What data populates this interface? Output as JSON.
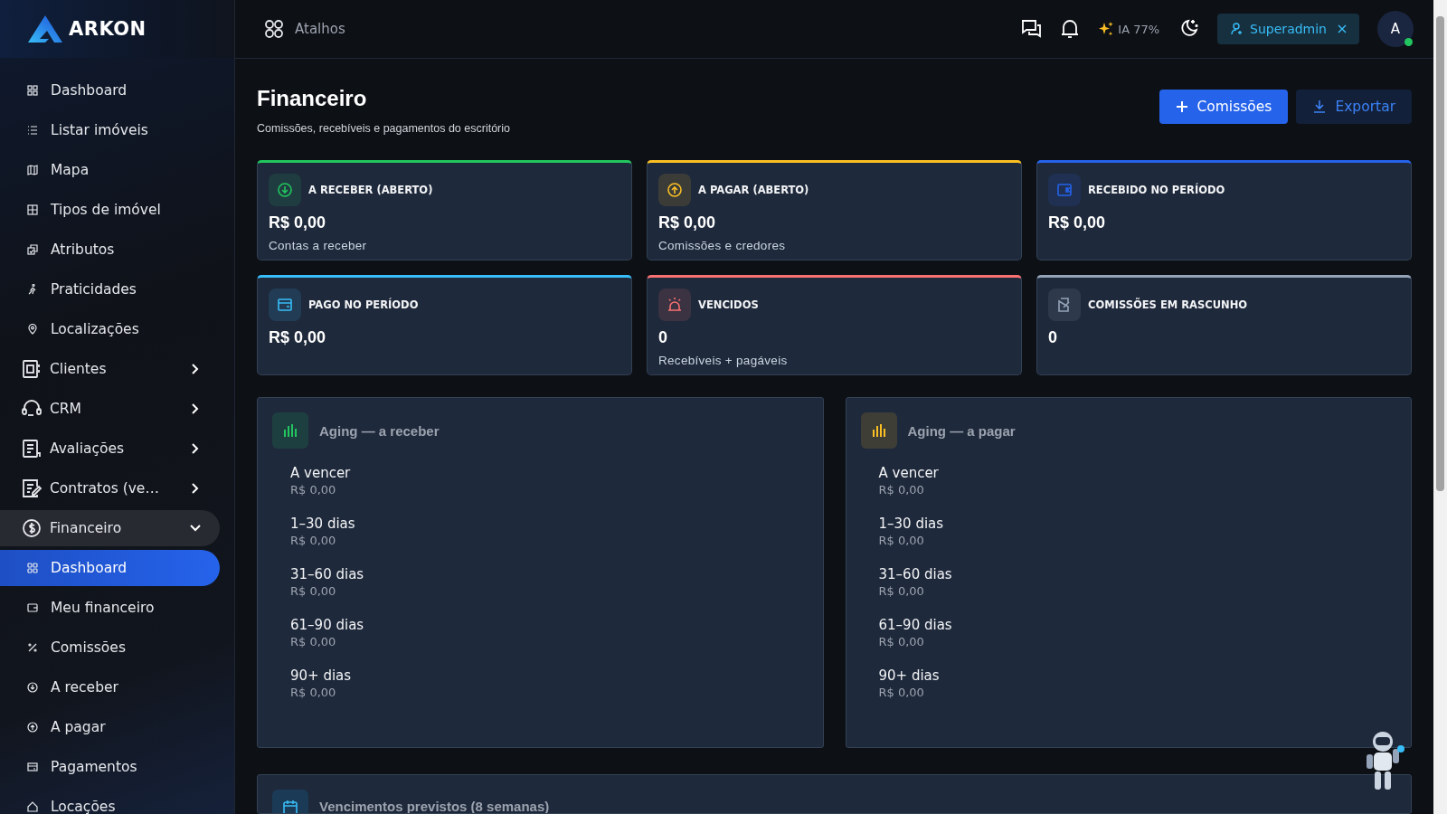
{
  "sidebar": {
    "logo": "ARKON",
    "items": [
      {
        "label": "Dashboard",
        "kind": "link",
        "selected": false
      },
      {
        "label": "Listar imóveis",
        "kind": "link",
        "selected": false
      },
      {
        "label": "Mapa",
        "kind": "link",
        "selected": false
      },
      {
        "label": "Tipos de imóvel",
        "kind": "link",
        "selected": false
      },
      {
        "label": "Atributos",
        "kind": "link",
        "selected": false
      },
      {
        "label": "Praticidades",
        "kind": "link",
        "selected": false
      },
      {
        "label": "Localizações",
        "kind": "link",
        "selected": false
      },
      {
        "label": "Clientes",
        "kind": "group",
        "expanded": false,
        "selected": false
      },
      {
        "label": "CRM",
        "kind": "group",
        "expanded": false,
        "selected": false
      },
      {
        "label": "Avaliações",
        "kind": "group",
        "expanded": false,
        "selected": false
      },
      {
        "label": "Contratos (ve…",
        "kind": "group",
        "expanded": false,
        "selected": false
      },
      {
        "label": "Financeiro",
        "kind": "group",
        "expanded": true,
        "selected": false,
        "children": [
          {
            "label": "Dashboard",
            "selected": true
          },
          {
            "label": "Meu financeiro",
            "selected": false
          },
          {
            "label": "Comissões",
            "selected": false
          },
          {
            "label": "A receber",
            "selected": false
          },
          {
            "label": "A pagar",
            "selected": false
          },
          {
            "label": "Pagamentos",
            "selected": false
          },
          {
            "label": "Locações",
            "selected": false
          }
        ]
      }
    ]
  },
  "topbar": {
    "shortcuts": "Atalhos",
    "ai_usage": "IA 77%",
    "role_chip": "Superadmin",
    "avatar": "A",
    "online": true
  },
  "page": {
    "title": "Financeiro",
    "subtitle": "Comissões, recebíveis e pagamentos do escritório",
    "buttons": [
      {
        "label": "Comissões",
        "kind": "primary"
      },
      {
        "label": "Exportar",
        "kind": "secondary"
      }
    ]
  },
  "metrics": [
    {
      "title": "A RECEBER (ABERTO)",
      "value": "R$ 0,00",
      "caption": "Contas a receber",
      "color": "#22c55e"
    },
    {
      "title": "A PAGAR (ABERTO)",
      "value": "R$ 0,00",
      "caption": "Comissões e credores",
      "color": "#fbbf24"
    },
    {
      "title": "RECEBIDO NO PERÍODO",
      "value": "R$ 0,00",
      "color": "#2563eb"
    },
    {
      "title": "PAGO NO PERÍODO",
      "value": "R$ 0,00",
      "color": "#38bdf8"
    },
    {
      "title": "VENCIDOS",
      "value": "0",
      "caption": "Recebíveis + pagáveis",
      "color": "#f87171"
    },
    {
      "title": "COMISSÕES EM RASCUNHO",
      "value": "0",
      "color": "#94a3b8"
    }
  ],
  "aging": [
    {
      "title": "Aging — a receber",
      "color": "#22c55e",
      "rows": [
        {
          "label": "A vencer",
          "amount": "R$ 0,00"
        },
        {
          "label": "1–30 dias",
          "amount": "R$ 0,00"
        },
        {
          "label": "31–60 dias",
          "amount": "R$ 0,00"
        },
        {
          "label": "61–90 dias",
          "amount": "R$ 0,00"
        },
        {
          "label": "90+ dias",
          "amount": "R$ 0,00"
        }
      ]
    },
    {
      "title": "Aging — a pagar",
      "color": "#fbbf24",
      "rows": [
        {
          "label": "A vencer",
          "amount": "R$ 0,00"
        },
        {
          "label": "1–30 dias",
          "amount": "R$ 0,00"
        },
        {
          "label": "31–60 dias",
          "amount": "R$ 0,00"
        },
        {
          "label": "61–90 dias",
          "amount": "R$ 0,00"
        },
        {
          "label": "90+ dias",
          "amount": "R$ 0,00"
        }
      ]
    }
  ],
  "forecast": {
    "title": "Vencimentos previstos (8 semanas)"
  }
}
